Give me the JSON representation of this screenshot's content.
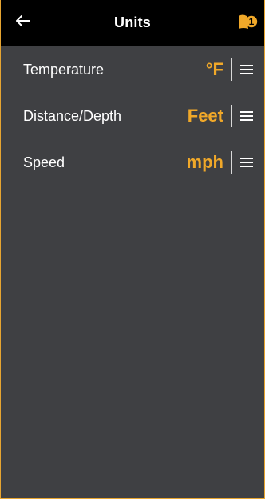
{
  "header": {
    "title": "Units",
    "back_icon": "arrow-left-icon",
    "alert_icon": "alert-badge-icon",
    "alert_count": "1",
    "accent_color": "#f0a829"
  },
  "settings": [
    {
      "label": "Temperature",
      "value": "°F"
    },
    {
      "label": "Distance/Depth",
      "value": "Feet"
    },
    {
      "label": "Speed",
      "value": "mph"
    }
  ]
}
